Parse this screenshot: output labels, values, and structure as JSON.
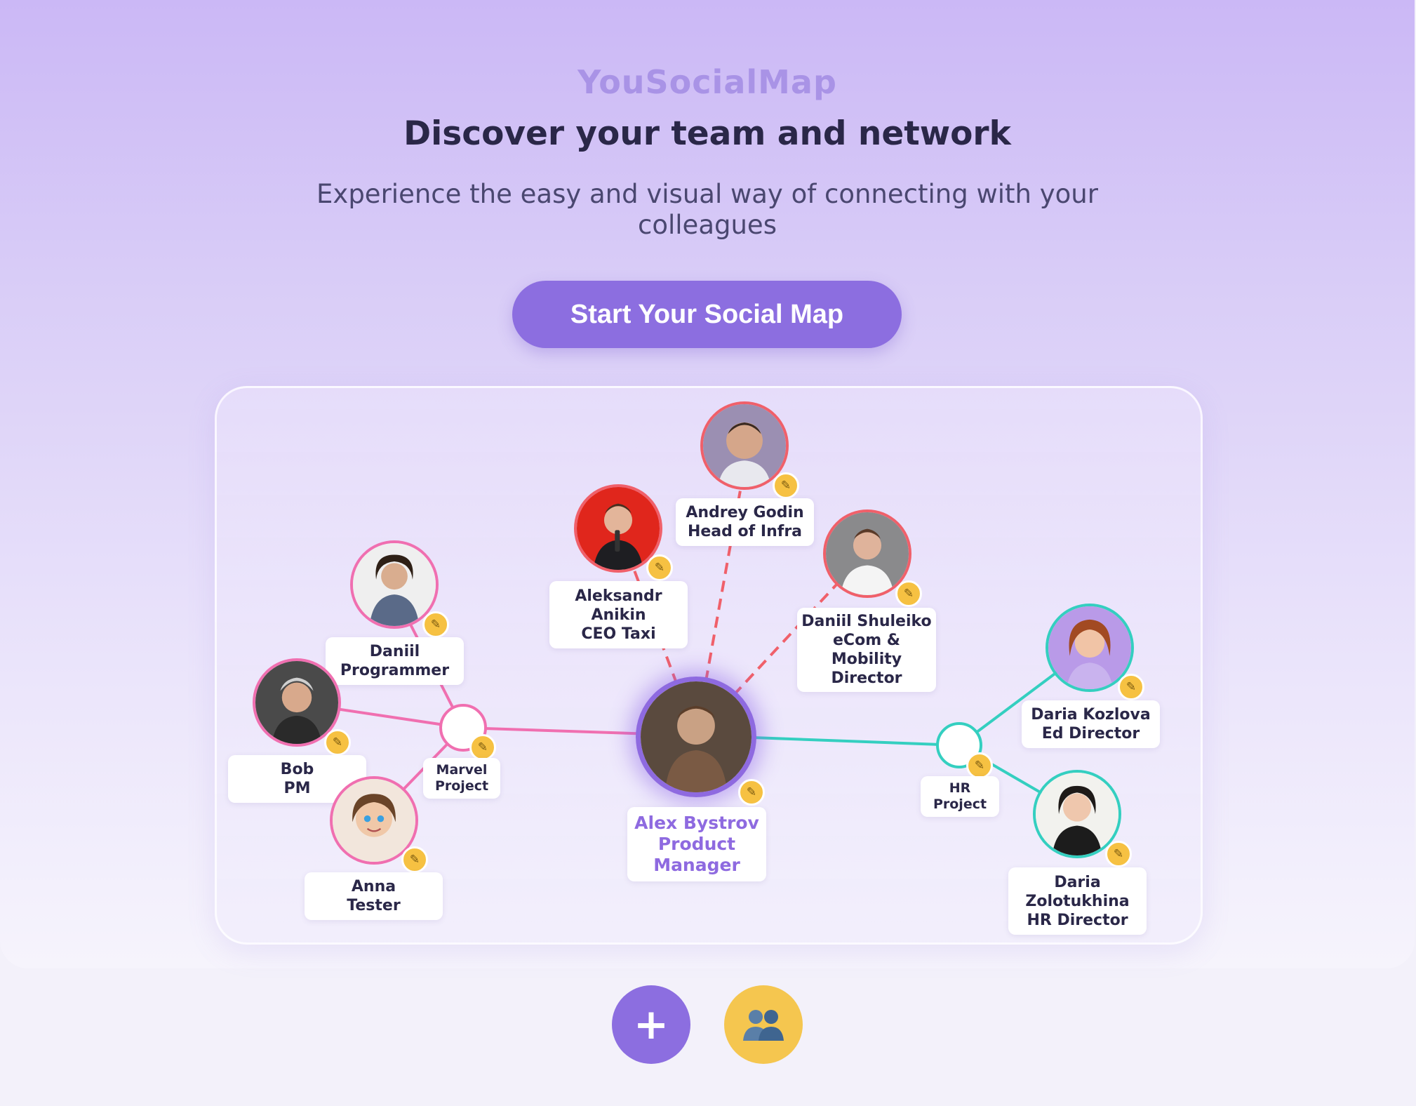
{
  "header": {
    "brand": "YouSocialMap",
    "headline": "Discover your team and network",
    "subheadline": "Experience the easy and visual way of connecting with your colleagues",
    "cta_label": "Start Your Social Map"
  },
  "colors": {
    "accent": "#8c6ee0",
    "pink_link": "#f06fb0",
    "red_link": "#f0606a",
    "teal_link": "#34cfc0",
    "edit_badge": "#f6c142"
  },
  "people": {
    "center": {
      "name": "Alex Bystrov",
      "role_line1": "Product",
      "role_line2": "Manager"
    },
    "andrey": {
      "line1": "Andrey Godin",
      "line2": "Head of Infra"
    },
    "aleksandr": {
      "line1": "Aleksandr",
      "line2": "Anikin",
      "line3": "CEO Taxi"
    },
    "shuleiko": {
      "line1": "Daniil Shuleiko",
      "line2": "eCom &",
      "line3": "Mobility",
      "line4": "Director"
    },
    "daniil": {
      "line1": "Daniil",
      "line2": "Programmer"
    },
    "bob": {
      "line1": "Bob",
      "line2": "PM"
    },
    "anna": {
      "line1": "Anna",
      "line2": "Tester"
    },
    "kozlova": {
      "line1": "Daria Kozlova",
      "line2": "Ed Director"
    },
    "zolotukhina": {
      "line1": "Daria",
      "line2": "Zolotukhina",
      "line3": "HR Director"
    }
  },
  "groups": {
    "marvel": {
      "line1": "Marvel",
      "line2": "Project"
    },
    "hr": {
      "line1": "HR",
      "line2": "Project"
    }
  },
  "icons": {
    "edit": "pencil-icon",
    "add": "plus-icon",
    "group": "group-icon"
  },
  "fab": {
    "add_label": "+"
  }
}
